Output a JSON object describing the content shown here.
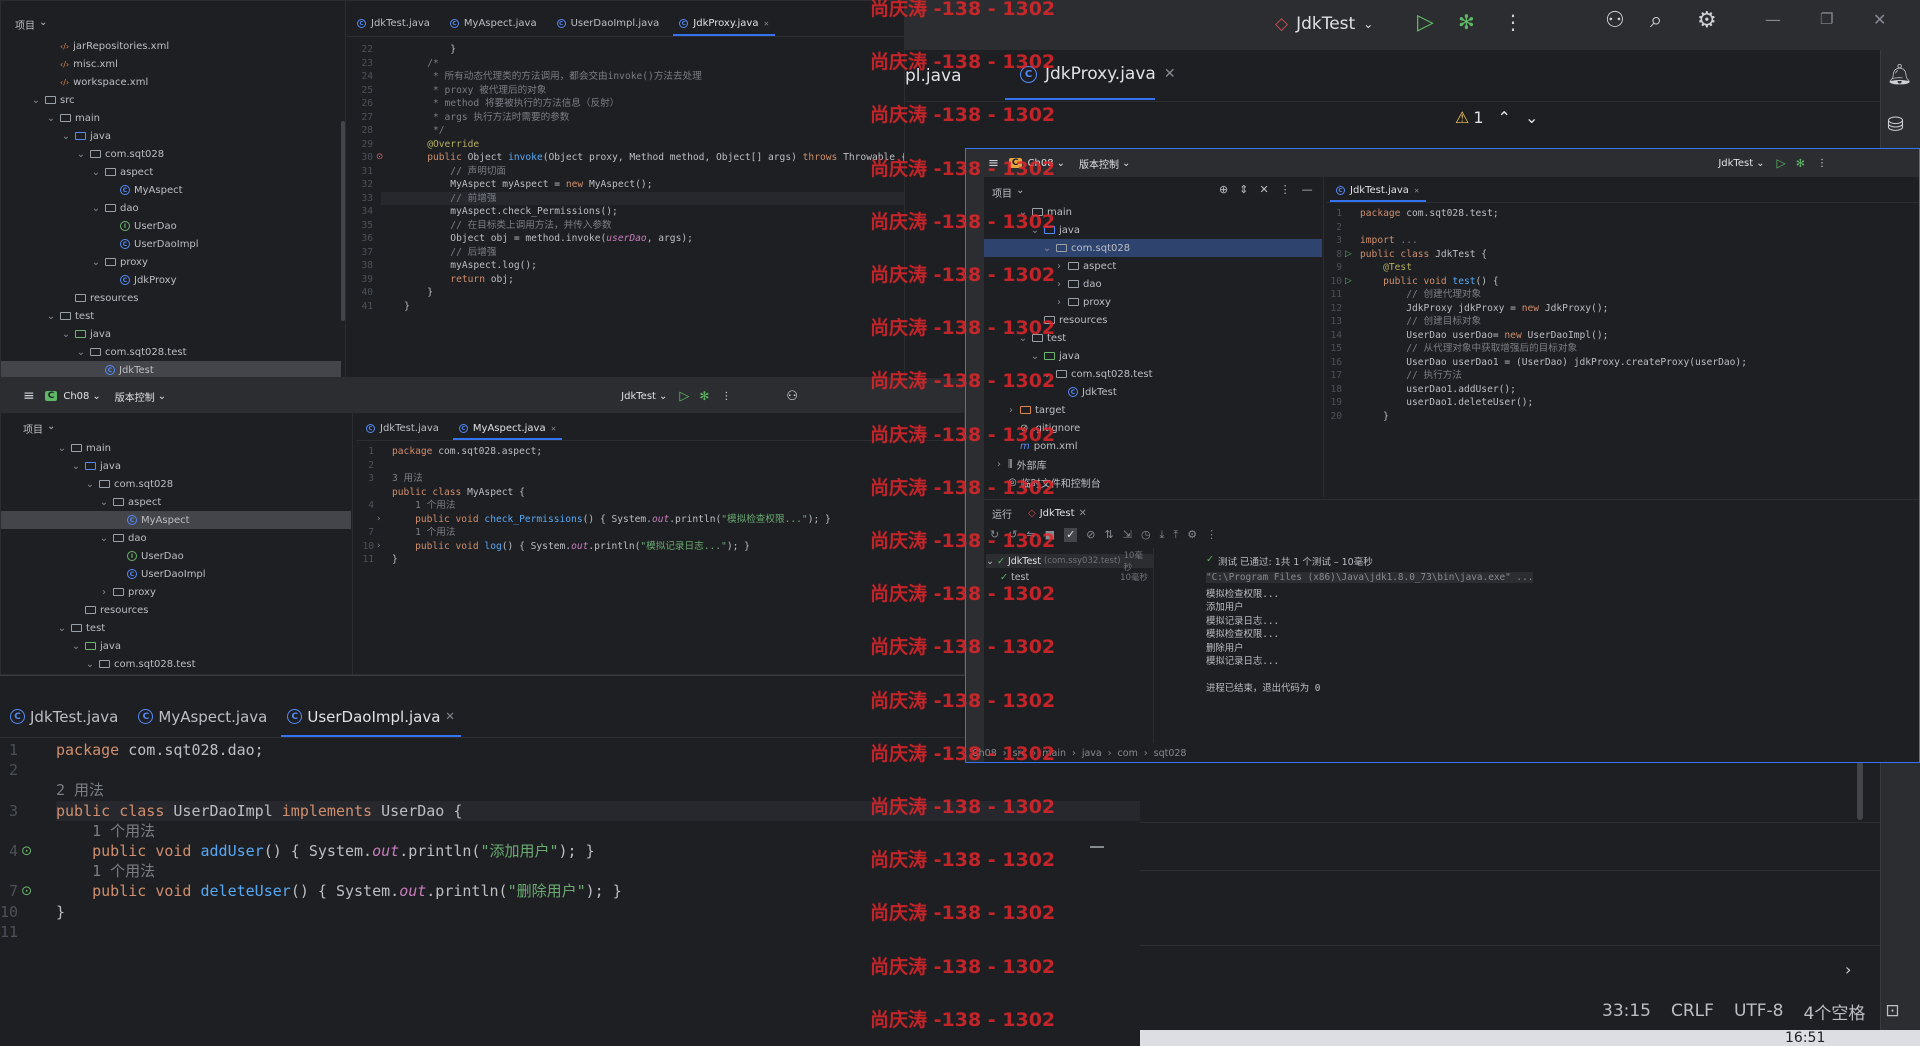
{
  "watermark": "尚庆涛 -138 - 1302",
  "bg_window": {
    "run_config": "JdkTest",
    "tabs": [
      "pl.java",
      "JdkProxy.java"
    ],
    "warn_count": "1",
    "status": {
      "position": "33:15",
      "line_sep": "CRLF",
      "encoding": "UTF-8",
      "indent": "4个空格"
    },
    "clock": "16:51",
    "gutter_letter": "m"
  },
  "win1": {
    "project_label": "项目",
    "tree": [
      "jarRepositories.xml",
      "misc.xml",
      "workspace.xml",
      "src",
      "main",
      "java",
      "com.sqt028",
      "aspect",
      "MyAspect",
      "dao",
      "UserDao",
      "UserDaoImpl",
      "proxy",
      "JdkProxy",
      "resources",
      "test",
      "java",
      "com.sqt028.test",
      "JdkTest"
    ],
    "tabs": [
      "JdkTest.java",
      "MyAspect.java",
      "UserDaoImpl.java",
      "JdkProxy.java"
    ],
    "warn": "1",
    "line_nums": [
      "22",
      "23",
      "24",
      "25",
      "26",
      "27",
      "28",
      "29",
      "30",
      "31",
      "32",
      "33",
      "34",
      "35",
      "36",
      "37",
      "38",
      "39",
      "40",
      "41"
    ],
    "code": [
      {
        "p": [
          [
            "            }",
            "cls"
          ]
        ]
      },
      {
        "p": [
          [
            "        /*",
            "cmt"
          ]
        ]
      },
      {
        "p": [
          [
            "         * 所有动态代理类的方法调用，都会交由invoke()方法去处理",
            "cmt"
          ]
        ]
      },
      {
        "p": [
          [
            "         * proxy 被代理后的对象",
            "cmt"
          ]
        ]
      },
      {
        "p": [
          [
            "         * method 将要被执行的方法信息（反射）",
            "cmt"
          ]
        ]
      },
      {
        "p": [
          [
            "         * args 执行方法时需要的参数",
            "cmt"
          ]
        ]
      },
      {
        "p": [
          [
            "         */",
            "cmt"
          ]
        ]
      },
      {
        "p": [
          [
            "        @Override",
            "ann"
          ]
        ]
      },
      {
        "p": [
          [
            "        public ",
            "kw"
          ],
          [
            "Object ",
            "cls"
          ],
          [
            "invoke",
            "fn"
          ],
          [
            "(Object proxy, Method method, Object[] args) ",
            "cls"
          ],
          [
            "throws ",
            "kw"
          ],
          [
            "Throwable {",
            "cls"
          ]
        ]
      },
      {
        "p": [
          [
            "            // 声明切面",
            "cmt"
          ]
        ]
      },
      {
        "p": [
          [
            "            MyAspect myAspect = ",
            "cls"
          ],
          [
            "new ",
            "kw"
          ],
          [
            "MyAspect();",
            "cls"
          ]
        ]
      },
      {
        "p": [
          [
            "            // 前增强",
            "cmt"
          ]
        ]
      },
      {
        "p": [
          [
            "            myAspect.check_Permissions();",
            "cls"
          ]
        ]
      },
      {
        "p": [
          [
            "            // 在目标类上调用方法，并传入参数",
            "cmt"
          ]
        ]
      },
      {
        "p": [
          [
            "            Object obj = method.invoke(",
            "cls"
          ],
          [
            "userDao",
            "it"
          ],
          [
            ", args);",
            "cls"
          ]
        ]
      },
      {
        "p": [
          [
            "            // 后增强",
            "cmt"
          ]
        ]
      },
      {
        "p": [
          [
            "            myAspect.log();",
            "cls"
          ]
        ]
      },
      {
        "p": [
          [
            "            return ",
            "kw"
          ],
          [
            "obj;",
            "cls"
          ]
        ]
      },
      {
        "p": [
          [
            "        }",
            "cls"
          ]
        ]
      },
      {
        "p": [
          [
            "    }",
            "cls"
          ]
        ]
      }
    ]
  },
  "win2": {
    "project": "Ch08",
    "vcs": "版本控制",
    "run_config": "JdkTest",
    "project_label": "项目",
    "tree": [
      "main",
      "java",
      "com.sqt028",
      "aspect",
      "MyAspect",
      "dao",
      "UserDao",
      "UserDaoImpl",
      "proxy",
      "resources",
      "test",
      "java",
      "com.sqt028.test"
    ],
    "tabs": [
      "JdkTest.java",
      "MyAspect.java"
    ],
    "line_nums": [
      "1",
      "2",
      "3",
      "",
      "4",
      "",
      "7",
      "10",
      "11"
    ],
    "code": [
      {
        "p": [
          [
            "package ",
            "kw"
          ],
          [
            "com.sqt028.aspect;",
            "cls"
          ]
        ]
      },
      {
        "p": [
          [
            "",
            "cls"
          ]
        ]
      },
      {
        "p": [
          [
            "3 用法",
            "hint"
          ]
        ]
      },
      {
        "p": [
          [
            "public class ",
            "kw"
          ],
          [
            "MyAspect {",
            "cls"
          ]
        ]
      },
      {
        "p": [
          [
            "    1 个用法",
            "hint"
          ]
        ]
      },
      {
        "p": [
          [
            "    public void ",
            "kw"
          ],
          [
            "check_Permissions",
            "fn"
          ],
          [
            "() { System.",
            "cls"
          ],
          [
            "out",
            "it"
          ],
          [
            ".println(",
            "cls"
          ],
          [
            "\"模拟检查权限...\"",
            "str"
          ],
          [
            "); }",
            "cls"
          ]
        ]
      },
      {
        "p": [
          [
            "    1 个用法",
            "hint"
          ]
        ]
      },
      {
        "p": [
          [
            "    public void ",
            "kw"
          ],
          [
            "log",
            "fn"
          ],
          [
            "() { System.",
            "cls"
          ],
          [
            "out",
            "it"
          ],
          [
            ".println(",
            "cls"
          ],
          [
            "\"模拟记录日志...\"",
            "str"
          ],
          [
            "); }",
            "cls"
          ]
        ]
      },
      {
        "p": [
          [
            "}",
            "cls"
          ]
        ]
      }
    ]
  },
  "win3": {
    "tabs": [
      "JdkTest.java",
      "MyAspect.java",
      "UserDaoImpl.java"
    ],
    "line_nums": [
      "1",
      "2",
      "",
      "3",
      "",
      "4",
      "",
      "7",
      "10",
      "11"
    ],
    "code": [
      {
        "p": [
          [
            "package ",
            "kw"
          ],
          [
            "com.sqt028.dao;",
            "cls"
          ]
        ]
      },
      {
        "p": [
          [
            "",
            "cls"
          ]
        ]
      },
      {
        "p": [
          [
            "2 用法",
            "hint"
          ]
        ]
      },
      {
        "p": [
          [
            "public class ",
            "kw"
          ],
          [
            "UserDaoImpl ",
            "cls"
          ],
          [
            "implements ",
            "kw"
          ],
          [
            "UserDao {",
            "cls"
          ]
        ]
      },
      {
        "p": [
          [
            "    1 个用法",
            "hint"
          ]
        ]
      },
      {
        "p": [
          [
            "    public void ",
            "kw"
          ],
          [
            "addUser",
            "fn"
          ],
          [
            "() { System.",
            "cls"
          ],
          [
            "out",
            "it"
          ],
          [
            ".println(",
            "cls"
          ],
          [
            "\"添加用户\"",
            "str"
          ],
          [
            "); }",
            "cls"
          ]
        ]
      },
      {
        "p": [
          [
            "    1 个用法",
            "hint"
          ]
        ]
      },
      {
        "p": [
          [
            "    public void ",
            "kw"
          ],
          [
            "deleteUser",
            "fn"
          ],
          [
            "() { System.",
            "cls"
          ],
          [
            "out",
            "it"
          ],
          [
            ".println(",
            "cls"
          ],
          [
            "\"删除用户\"",
            "str"
          ],
          [
            "); }",
            "cls"
          ]
        ]
      },
      {
        "p": [
          [
            "}",
            "cls"
          ]
        ]
      },
      {
        "p": [
          [
            "",
            "cls"
          ]
        ]
      }
    ]
  },
  "win4": {
    "project": "Ch08",
    "vcs": "版本控制",
    "run_config": "JdkTest",
    "project_label": "项目",
    "tree": [
      "main",
      "java",
      "com.sqt028",
      "aspect",
      "dao",
      "proxy",
      "resources",
      "test",
      "java",
      "com.sqt028.test",
      "JdkTest",
      "target",
      ".gitignore",
      "pom.xml",
      "外部库",
      "临时文件和控制台"
    ],
    "tabs": [
      "JdkTest.java"
    ],
    "line_nums": [
      "1",
      "2",
      "3",
      "8",
      "9",
      "10",
      "11",
      "12",
      "13",
      "14",
      "15",
      "16",
      "17",
      "18",
      "19",
      "20"
    ],
    "code": [
      {
        "p": [
          [
            "package ",
            "kw"
          ],
          [
            "com.sqt028.test;",
            "cls"
          ]
        ]
      },
      {
        "p": [
          [
            "",
            "cls"
          ]
        ]
      },
      {
        "p": [
          [
            "import ",
            "kw"
          ],
          [
            "...",
            "hint"
          ]
        ]
      },
      {
        "p": [
          [
            "public class ",
            "kw"
          ],
          [
            "JdkTest {",
            "cls"
          ]
        ]
      },
      {
        "p": [
          [
            "    @Test",
            "ann"
          ]
        ]
      },
      {
        "p": [
          [
            "    public void ",
            "kw"
          ],
          [
            "test",
            "fn"
          ],
          [
            "() {",
            "cls"
          ]
        ]
      },
      {
        "p": [
          [
            "        // 创建代理对象",
            "cmt"
          ]
        ]
      },
      {
        "p": [
          [
            "        JdkProxy jdkProxy = ",
            "cls"
          ],
          [
            "new ",
            "kw"
          ],
          [
            "JdkProxy();",
            "cls"
          ]
        ]
      },
      {
        "p": [
          [
            "        // 创建目标对象",
            "cmt"
          ]
        ]
      },
      {
        "p": [
          [
            "        UserDao userDao= ",
            "cls"
          ],
          [
            "new ",
            "kw"
          ],
          [
            "UserDaoImpl();",
            "cls"
          ]
        ]
      },
      {
        "p": [
          [
            "        // 从代理对象中获取增强后的目标对象",
            "cmt"
          ]
        ]
      },
      {
        "p": [
          [
            "        UserDao userDao1 = (UserDao) jdkProxy.createProxy(userDao);",
            "cls"
          ]
        ]
      },
      {
        "p": [
          [
            "        // 执行方法",
            "cmt"
          ]
        ]
      },
      {
        "p": [
          [
            "        userDao1.addUser();",
            "cls"
          ]
        ]
      },
      {
        "p": [
          [
            "        userDao1.deleteUser();",
            "cls"
          ]
        ]
      },
      {
        "p": [
          [
            "    }",
            "cls"
          ]
        ]
      }
    ],
    "run": {
      "label": "运行",
      "tab": "JdkTest",
      "test_root": "JdkTest",
      "test_root_pkg": "(com.ssy032.test)",
      "test_root_time": "10毫秒",
      "test_child": "test",
      "test_child_time": "10毫秒",
      "status": "测试 已通过: 1共 1 个测试 – 10毫秒",
      "console": [
        "\"C:\\Program Files (x86)\\Java\\jdk1.8.0_73\\bin\\java.exe\" ...",
        "模拟检查权限...",
        "添加用户",
        "模拟记录日志...",
        "模拟检查权限...",
        "删除用户",
        "模拟记录日志...",
        "",
        "进程已结束，退出代码为 0"
      ]
    },
    "breadcrumb": [
      "Ch08",
      "src",
      "main",
      "java",
      "com",
      "sqt028"
    ]
  }
}
